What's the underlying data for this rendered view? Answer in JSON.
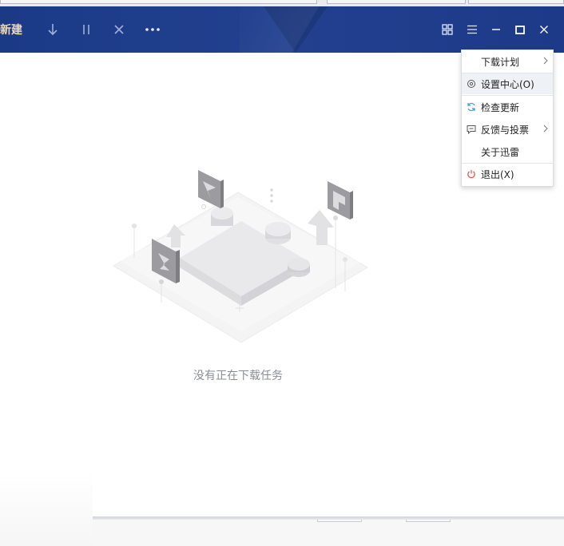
{
  "toolbar": {
    "new_label": "新建",
    "icons": [
      "download-icon",
      "pause-icon",
      "delete-icon",
      "more-icon",
      "grid-view-icon",
      "menu-icon",
      "minimize-icon",
      "maximize-icon",
      "close-icon"
    ]
  },
  "menu": {
    "items": [
      {
        "label": "下载计划",
        "icon": "",
        "has_submenu": true
      },
      {
        "label": "设置中心(O)",
        "icon": "gear-icon",
        "has_submenu": false
      },
      {
        "label": "检查更新",
        "icon": "refresh-icon",
        "has_submenu": false
      },
      {
        "label": "反馈与投票",
        "icon": "feedback-icon",
        "has_submenu": true
      },
      {
        "label": "关于迅雷",
        "icon": "",
        "has_submenu": false
      },
      {
        "label": "退出(X)",
        "icon": "power-icon",
        "has_submenu": false
      }
    ]
  },
  "main": {
    "empty_text": "没有正在下载任务"
  },
  "colors": {
    "toolbar_bg": "#1f3c8b",
    "accent_new": "#f3d9a8",
    "refresh_icon": "#3a9bd8",
    "power_icon": "#e0594c"
  }
}
